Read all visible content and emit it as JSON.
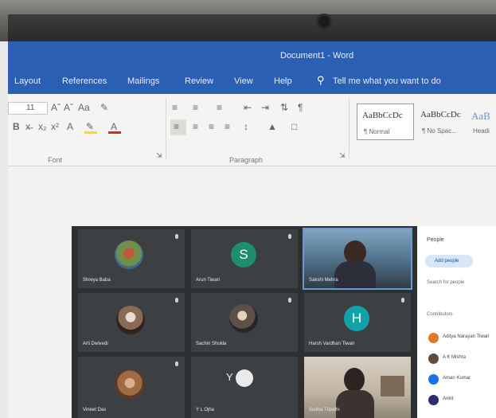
{
  "window": {
    "title": "Document1 - Word"
  },
  "menu": {
    "tabs": [
      "Layout",
      "References",
      "Mailings",
      "Review",
      "View",
      "Help"
    ],
    "tell_me": "Tell me what you want to do"
  },
  "ribbon": {
    "font_size": "11",
    "font_group": "Font",
    "paragraph_group": "Paragraph",
    "styles": [
      {
        "preview": "AaBbCcDc",
        "name": "¶ Normal"
      },
      {
        "preview": "AaBbCcDc",
        "name": "¶ No Spac..."
      },
      {
        "preview": "AaB",
        "name": "Headi"
      }
    ]
  },
  "meet": {
    "tiles": [
      {
        "name": "Shreya Baba",
        "kind": "photo",
        "avatar_color": "#6f8f4a"
      },
      {
        "name": "Arun Tiwari",
        "kind": "letter",
        "letter": "S",
        "avatar_color": "#1e8e6e"
      },
      {
        "name": "Sakshi Mehra",
        "kind": "video"
      },
      {
        "name": "Arti Dwivedi",
        "kind": "photo",
        "avatar_color": "#8a6a55"
      },
      {
        "name": "Sachin Shukla",
        "kind": "photo",
        "avatar_color": "#5c5048"
      },
      {
        "name": "Harsh Vardhan Tiwari",
        "kind": "letter",
        "letter": "H",
        "avatar_color": "#12a3a8"
      },
      {
        "name": "Vineet Das",
        "kind": "photo",
        "avatar_color": "#a06a44"
      },
      {
        "name": "Y L Ojha",
        "kind": "letters",
        "letter": "Y"
      },
      {
        "name": "Sudha Tripathi",
        "kind": "video"
      }
    ]
  },
  "panel": {
    "header": "People",
    "button": "Add people",
    "search": "Search for people",
    "section": "Contributors",
    "people": [
      {
        "name": "Aditya Narayan Tiwari",
        "color": "#e07a2a"
      },
      {
        "name": "A K Mishra",
        "color": "#5b4c3e"
      },
      {
        "name": "Aman Kumar",
        "color": "#1a73e8"
      },
      {
        "name": "Ankit",
        "color": "#2c2c6e"
      }
    ]
  }
}
